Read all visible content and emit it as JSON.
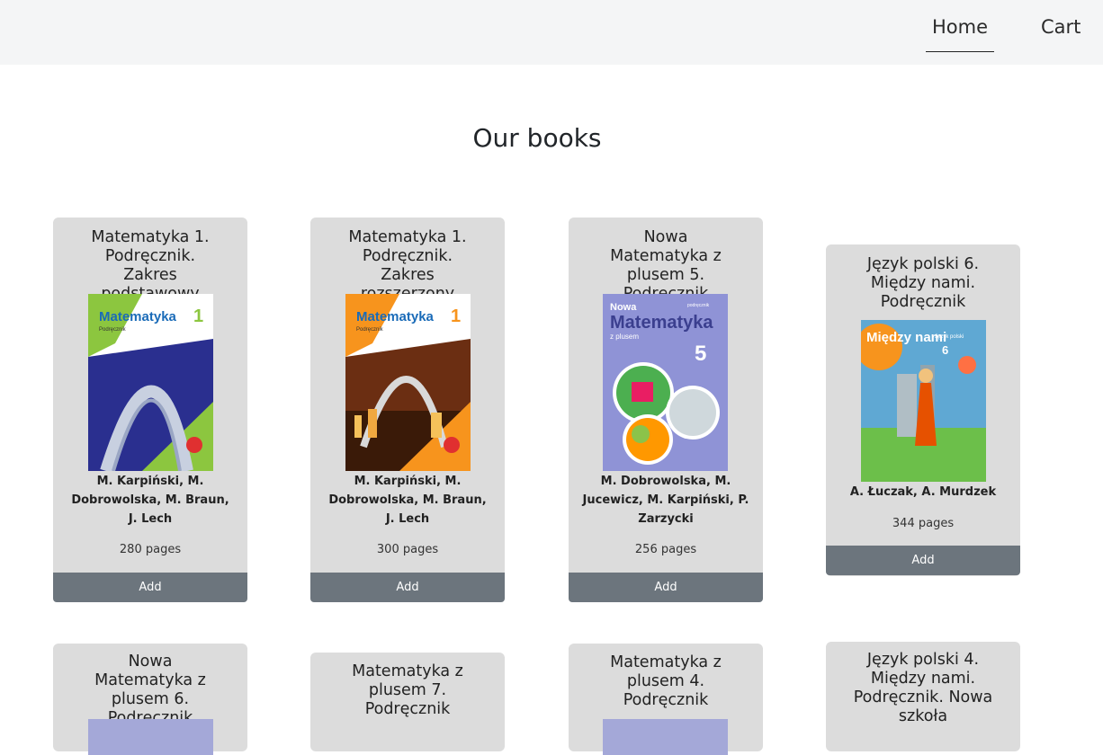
{
  "nav": {
    "home_label": "Home",
    "cart_label": "Cart"
  },
  "main": {
    "title": "Our books"
  },
  "books": [
    {
      "title": "Matematyka 1. Podręcznik. Zakres podstawowy",
      "authors": "M. Karpiński, M. Dobrowolska, M. Braun, J. Lech",
      "pages": "280 pages",
      "add_label": "Add",
      "cover": {
        "title": "Matematyka",
        "number": "1",
        "subtitle": "Podręcznik",
        "colors": [
          "#8cc63f",
          "#1e2a8c",
          "#ffffff"
        ]
      }
    },
    {
      "title": "Matematyka 1. Podręcznik. Zakres rozszerzony",
      "authors": "M. Karpiński, M. Dobrowolska, M. Braun, J. Lech",
      "pages": "300 pages",
      "add_label": "Add",
      "cover": {
        "title": "Matematyka",
        "number": "1",
        "subtitle": "Podręcznik",
        "colors": [
          "#f7941d",
          "#5a2a0e",
          "#ffffff"
        ]
      }
    },
    {
      "title": "Nowa Matematyka z plusem 5. Podręcznik",
      "authors": "M. Dobrowolska, M. Jucewicz, M. Karpiński, P. Zarzycki",
      "pages": "256 pages",
      "add_label": "Add",
      "cover": {
        "title": "Matematyka",
        "pre": "Nowa",
        "subtitle": "z plusem",
        "number": "5",
        "badge": "podręcznik",
        "colors": [
          "#8f93d6",
          "#ffffff",
          "#3b3f8f"
        ]
      }
    },
    {
      "title": "Język polski 6. Między nami. Podręcznik",
      "authors": "A. Łuczak, A. Murdzek",
      "pages": "344 pages",
      "add_label": "Add",
      "cover": {
        "title": "Między nami",
        "subtitle": "Język polski",
        "number": "6",
        "colors": [
          "#f7941d",
          "#6cbf4a",
          "#ffffff"
        ]
      }
    },
    {
      "title": "Nowa Matematyka z plusem 6. Podręcznik"
    },
    {
      "title": "Matematyka z plusem 7. Podręcznik"
    },
    {
      "title": "Matematyka z plusem 4. Podręcznik"
    },
    {
      "title": "Język polski 4. Między nami. Podręcznik. Nowa szkoła"
    }
  ],
  "colors": {
    "navbar_bg": "#f4f5f6",
    "card_bg": "#dcdcdc",
    "button_bg": "#6c757d"
  }
}
